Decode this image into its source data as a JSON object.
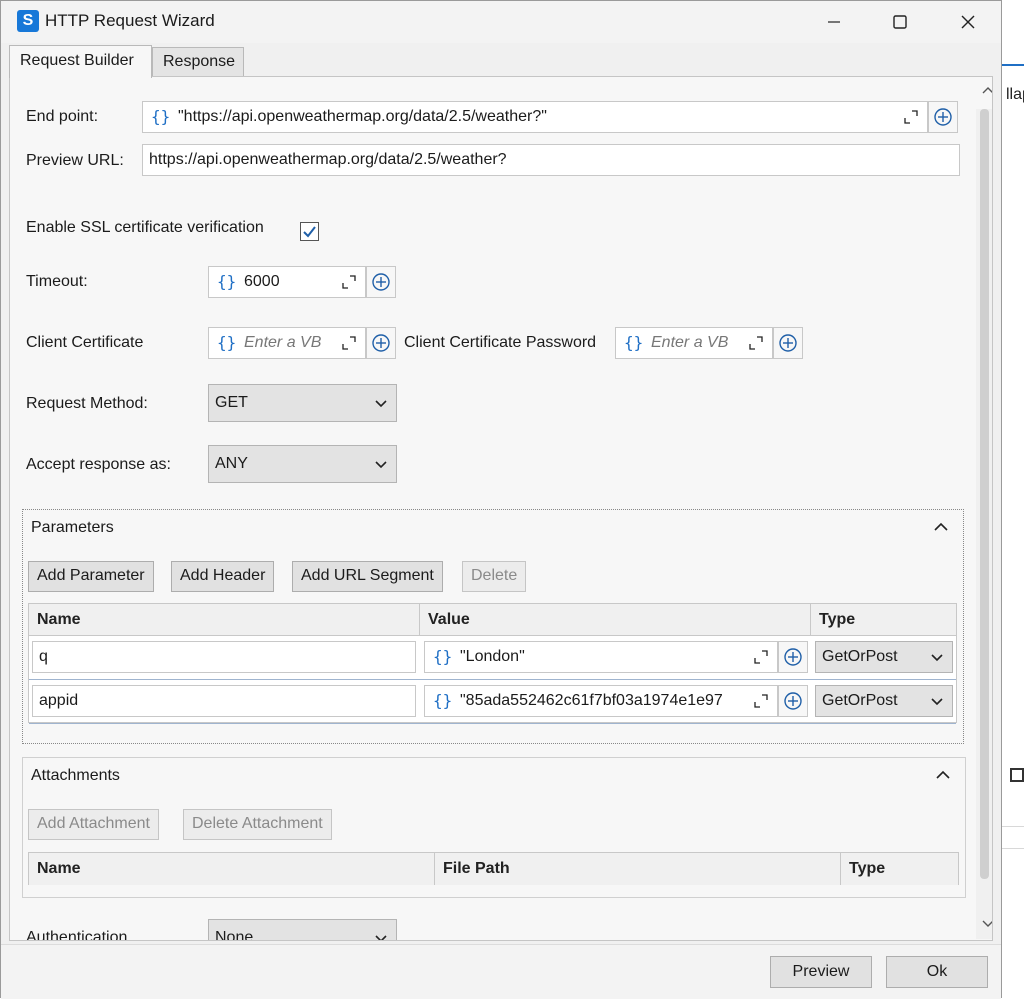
{
  "window": {
    "title": "HTTP Request Wizard",
    "app_icon": "uipath-s-icon"
  },
  "tabs": [
    {
      "label": "Request Builder",
      "active": true
    },
    {
      "label": "Response",
      "active": false
    }
  ],
  "background_app": {
    "partial_text": "llap"
  },
  "form": {
    "endpoint_label": "End point:",
    "endpoint_value": "\"https://api.openweathermap.org/data/2.5/weather?\"",
    "preview_label": "Preview URL:",
    "preview_value": "https://api.openweathermap.org/data/2.5/weather?",
    "ssl_label": "Enable SSL certificate verification",
    "ssl_checked": true,
    "timeout_label": "Timeout:",
    "timeout_value": "6000",
    "client_cert_label": "Client Certificate",
    "client_cert_placeholder": "Enter a VB",
    "client_cert_pwd_label": "Client Certificate Password",
    "client_cert_pwd_placeholder": "Enter a VB",
    "method_label": "Request Method:",
    "method_value": "GET",
    "accept_label": "Accept response as:",
    "accept_value": "ANY",
    "auth_label": "Authentication",
    "auth_value": "None"
  },
  "parameters": {
    "header": "Parameters",
    "buttons": {
      "add_parameter": "Add Parameter",
      "add_header": "Add Header",
      "add_url_segment": "Add URL Segment",
      "delete": "Delete"
    },
    "columns": [
      "Name",
      "Value",
      "Type"
    ],
    "rows": [
      {
        "name": "q",
        "value": "\"London\"",
        "type": "GetOrPost"
      },
      {
        "name": "appid",
        "value": "\"85ada552462c61f7bf03a1974e1e97",
        "type": "GetOrPost"
      }
    ]
  },
  "attachments": {
    "header": "Attachments",
    "buttons": {
      "add_attachment": "Add Attachment",
      "delete_attachment": "Delete Attachment"
    },
    "columns": [
      "Name",
      "File Path",
      "Type"
    ]
  },
  "footer": {
    "preview": "Preview",
    "ok": "Ok"
  },
  "colors": {
    "accent": "#1f6fc5",
    "window_bg": "#f0f0f0"
  }
}
